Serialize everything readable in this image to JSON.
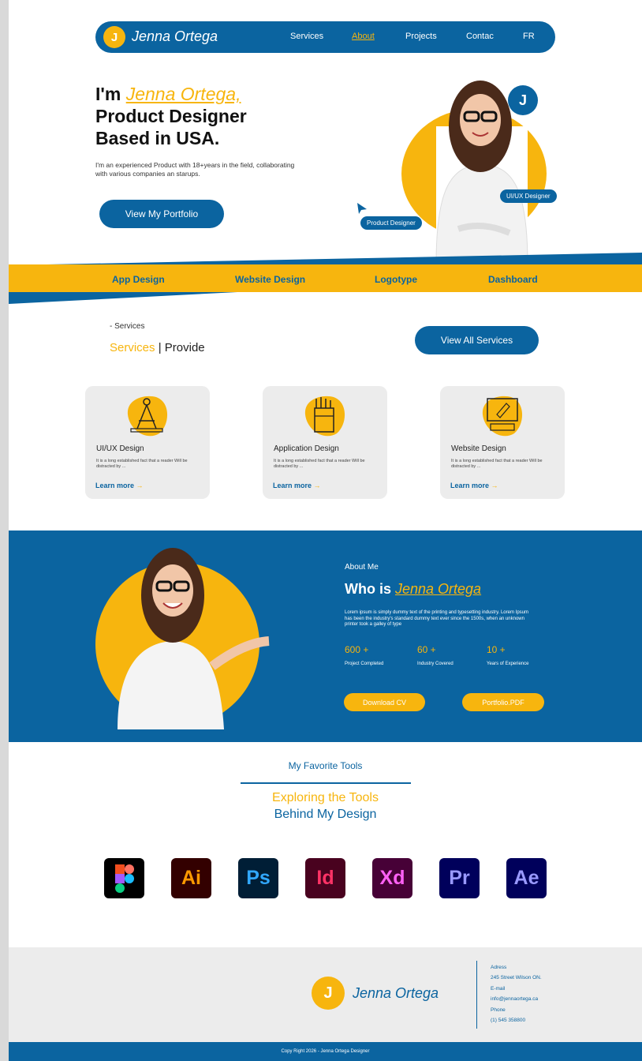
{
  "nav": {
    "logo_letter": "J",
    "name": "Jenna Ortega",
    "links": [
      "Services",
      "About",
      "Projects",
      "Contac",
      "FR"
    ]
  },
  "hero": {
    "prefix": "I'm ",
    "name": "Jenna Ortega,",
    "line2": "Product Designer",
    "line3": "Based in USA.",
    "description": "I'm an experienced Product with 18+years in the field, collaborating with various companies an starups.",
    "cta": "View My Portfolio",
    "badge_letter": "J",
    "chip_right": "UI/UX Designer",
    "chip_left": "Product Designer"
  },
  "band": {
    "items": [
      "App Design",
      "Website Design",
      "Logotype",
      "Dashboard"
    ]
  },
  "services": {
    "crumb": "- Services",
    "title_accent": "Services",
    "title_rest": " | Provide",
    "view_all": "View All Services",
    "cards": [
      {
        "title": "UI/UX Design",
        "text": "It is a long established fact that a reader Will be distracted by ...",
        "link": "Learn more",
        "icon": "compass-icon"
      },
      {
        "title": "Application Design",
        "text": "It is a long established fact that a reader Will be distracted by ...",
        "link": "Learn more",
        "icon": "pencil-cup-icon"
      },
      {
        "title": "Website Design",
        "text": "It is a long established fact that a reader Will be distracted by ...",
        "link": "Learn more",
        "icon": "monitor-icon"
      }
    ],
    "arrow": "→"
  },
  "about": {
    "small": "About Me",
    "title_prefix": "Who is ",
    "title_name": "Jenna Ortega",
    "description": "Lorem ipsum is simply dummy text of the printing and typesetting industry. Lorem Ipsum has been the industry's standard dummy text ever since the 1500s, when an unknown printer took a galley of type",
    "stats": [
      {
        "value": "600 +",
        "label": "Project Completed"
      },
      {
        "value": "60 +",
        "label": "Industry Covered"
      },
      {
        "value": "10 +",
        "label": "Years of Experience"
      }
    ],
    "btn_cv": "Download CV",
    "btn_pdf": "Portfolio.PDF"
  },
  "tools": {
    "small": "My Favorite Tools",
    "h1": "Exploring the Tools",
    "h2": "Behind My Design",
    "items": [
      {
        "label": "",
        "name": "figma-icon"
      },
      {
        "label": "Ai",
        "name": "illustrator-icon"
      },
      {
        "label": "Ps",
        "name": "photoshop-icon"
      },
      {
        "label": "Id",
        "name": "indesign-icon"
      },
      {
        "label": "Xd",
        "name": "xd-icon"
      },
      {
        "label": "Pr",
        "name": "premiere-icon"
      },
      {
        "label": "Ae",
        "name": "after-effects-icon"
      }
    ]
  },
  "footer": {
    "logo_letter": "J",
    "name": "Jenna Ortega",
    "adress_label": "Adress",
    "adress": "245 Street Wilson ON.",
    "email_label": "E-mail",
    "email": "info@jennaortega.ca",
    "phone_label": "Phone",
    "phone": "(1) 545 358800",
    "copyright": "Copy Right 2026 - Jenna Ortega Designer"
  },
  "colors": {
    "primary": "#0b64a0",
    "accent": "#f7b50e"
  }
}
